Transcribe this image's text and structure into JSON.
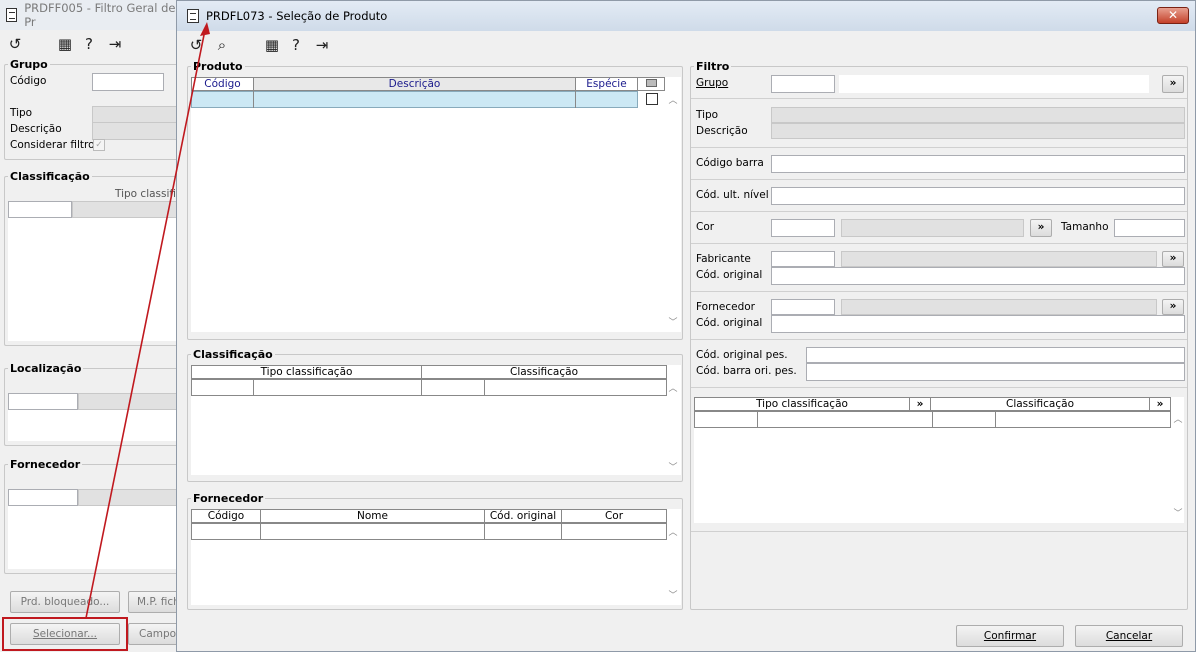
{
  "back_window": {
    "title": "PRDFF005 - Filtro Geral de Pr",
    "grupo_title": "Grupo",
    "codigo_label": "Código",
    "tipo_label": "Tipo",
    "descricao_label": "Descrição",
    "considerar_label": "Considerar filtro",
    "classificacao_title": "Classificação",
    "tipo_classif_header": "Tipo classifi",
    "localizacao_title": "Localização",
    "fornecedor_title": "Fornecedor",
    "btn_prd_bloqueado": "Prd. bloqueado...",
    "btn_mp_fich": "M.P. fich",
    "btn_selecionar": "Selecionar...",
    "btn_campo": "Campo"
  },
  "main_window": {
    "title": "PRDFL073 - Seleção de Produto",
    "close_label": "✕",
    "produto": {
      "title": "Produto",
      "headers": [
        "Código",
        "Descrição",
        "Espécie"
      ]
    },
    "classificacao": {
      "title": "Classificação",
      "headers": [
        "Tipo classificação",
        "Classificação"
      ]
    },
    "fornecedor": {
      "title": "Fornecedor",
      "headers": [
        "Código",
        "Nome",
        "Cód. original",
        "Cor"
      ]
    },
    "filtro": {
      "title": "Filtro",
      "grupo_label": "Grupo",
      "tipo_label": "Tipo",
      "descricao_label": "Descrição",
      "codigo_barra_label": "Código barra",
      "cod_ult_nivel_label": "Cód. ult. nível",
      "cor_label": "Cor",
      "tamanho_label": "Tamanho",
      "fabricante_label": "Fabricante",
      "cod_original_label": "Cód. original",
      "fornecedor_label": "Fornecedor",
      "cod_original2_label": "Cód. original",
      "cod_original_pes_label": "Cód. original pes.",
      "cod_barra_ori_pes_label": "Cód. barra ori. pes.",
      "more_label": "»",
      "grid_headers": [
        "Tipo classificação",
        "Classificação"
      ]
    },
    "btn_confirmar": "Confirmar",
    "btn_cancelar": "Cancelar"
  },
  "colors": {
    "highlight_row": "#cce8f4",
    "annotation": "#c0191f",
    "title_active": "#dbe5f1",
    "window_bg": "#f0f0f0"
  }
}
